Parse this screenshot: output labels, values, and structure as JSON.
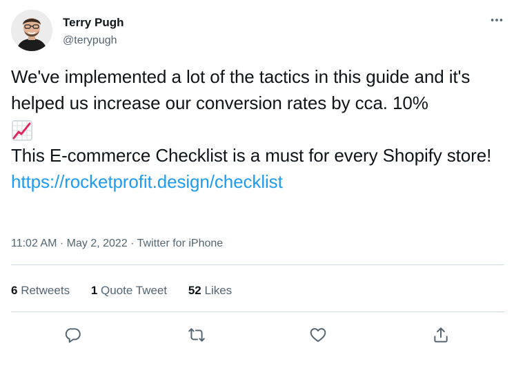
{
  "author": {
    "display_name": "Terry Pugh",
    "handle": "@terypugh"
  },
  "tweet": {
    "line1": "We've implemented a lot of the tactics in this guide and it's helped us increase our conversion rates by cca. 10%",
    "emoji": "chart-increasing-emoji",
    "line2_prefix": "This E-commerce Checklist is a must for every Shopify store!",
    "link": "https://rocketprofit.design/checklist"
  },
  "meta": {
    "time": "11:02 AM",
    "date": "May 2, 2022",
    "source": "Twitter for iPhone",
    "separator": "·"
  },
  "stats": {
    "retweets_count": "6",
    "retweets_label": "Retweets",
    "quotes_count": "1",
    "quotes_label": "Quote Tweet",
    "likes_count": "52",
    "likes_label": "Likes"
  },
  "icons": {
    "more": "more-icon",
    "reply": "reply-icon",
    "retweet": "retweet-icon",
    "like": "like-icon",
    "share": "share-icon"
  },
  "colors": {
    "link": "#1d9bf0",
    "secondary_text": "#536471",
    "primary_text": "#0f1419",
    "divider": "#cfd9de"
  }
}
